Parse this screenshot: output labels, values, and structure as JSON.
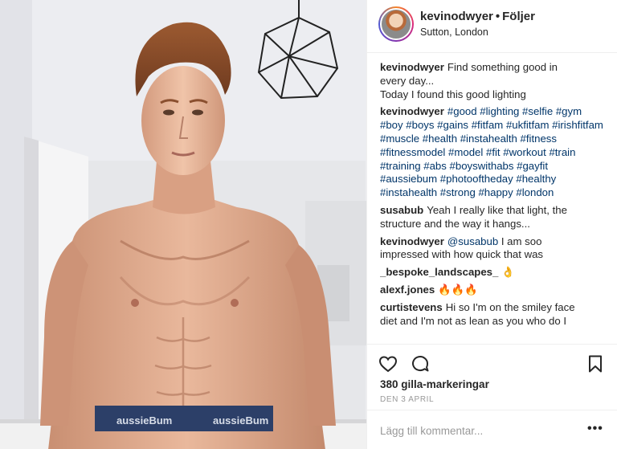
{
  "post": {
    "username": "kevinodwyer",
    "follow_label": "Följer",
    "location": "Sutton, London"
  },
  "comments": [
    {
      "user": "kevinodwyer",
      "lines": [
        "Find something good in",
        "every day...",
        "Today I found this good lighting"
      ]
    },
    {
      "user": "kevinodwyer",
      "tags": [
        "#good",
        "#lighting",
        "#selfie",
        "#gym",
        "#boy",
        "#boys",
        "#gains",
        "#fitfam",
        "#ukfitfam",
        "#irishfitfam",
        "#muscle",
        "#health",
        "#instahealth",
        "#fitness",
        "#fitnessmodel",
        "#model",
        "#fit",
        "#workout",
        "#train",
        "#training",
        "#abs",
        "#boyswithabs",
        "#gayfit",
        "#aussiebum",
        "#photooftheday",
        "#healthy",
        "#instahealth",
        "#strong",
        "#happy",
        "#london"
      ]
    },
    {
      "user": "susabub",
      "lines": [
        "Yeah I really like that light, the",
        "structure and the way it hangs..."
      ]
    },
    {
      "user": "kevinodwyer",
      "mention": "@susabub",
      "lines": [
        "I am soo",
        "impressed with how quick that was"
      ]
    },
    {
      "user": "_bespoke_landscapes_",
      "lines": [
        "👌"
      ]
    },
    {
      "user": "alexf.jones",
      "lines": [
        "🔥🔥🔥"
      ]
    },
    {
      "user": "curtistevens",
      "lines": [
        "Hi so I'm on the smiley face",
        "diet and I'm not as lean as you who do I"
      ]
    }
  ],
  "actions": {
    "like_icon": "heart-icon",
    "comment_icon": "comment-icon",
    "save_icon": "bookmark-icon"
  },
  "likes_text": "380 gilla-markeringar",
  "date_text": "DEN 3 APRIL",
  "add_comment": {
    "placeholder": "Lägg till kommentar...",
    "more_label": "•••"
  },
  "photo": {
    "waistband_text": "aussieBum"
  }
}
